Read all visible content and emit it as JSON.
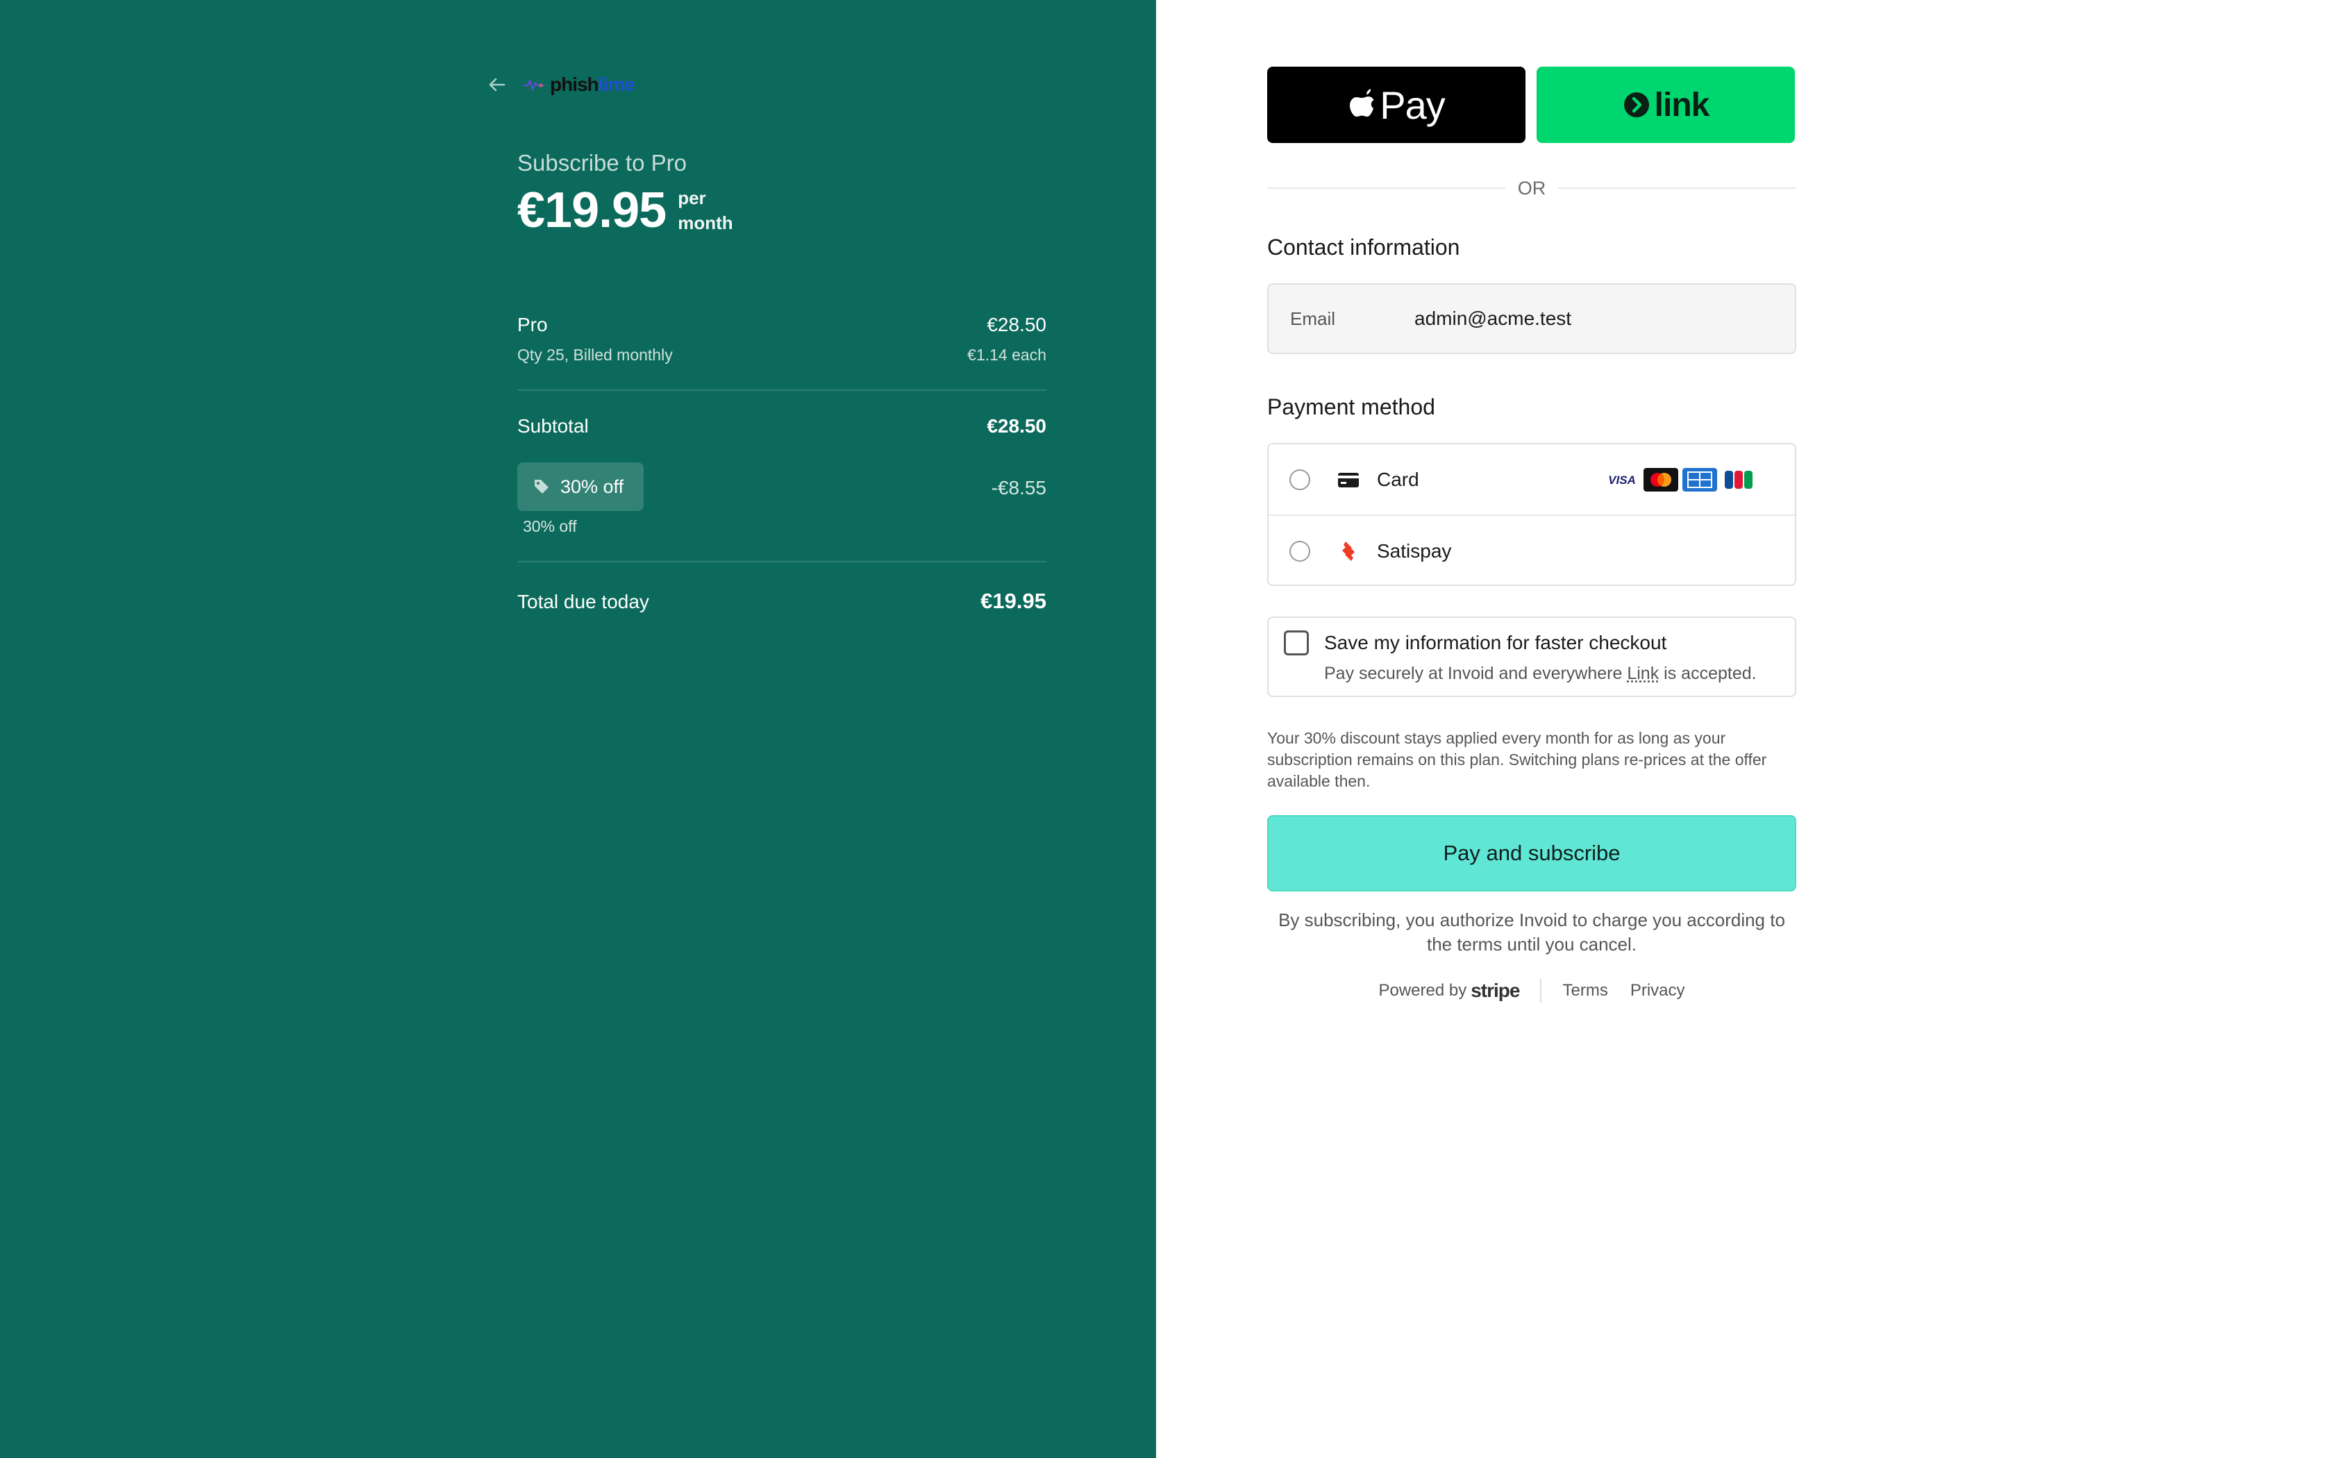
{
  "brand": {
    "logo_prefix": "phish",
    "logo_suffix": "lime",
    "logo_accent_color": "#1e4fd6"
  },
  "summary": {
    "subscribe_title": "Subscribe to Pro",
    "price": "€19.95",
    "period": "per month",
    "panel_color": "#0b6a5b",
    "line_item": {
      "name": "Pro",
      "price": "€28.50",
      "meta": "Qty 25, Billed monthly",
      "unit_price": "€1.14 each"
    },
    "subtotal_label": "Subtotal",
    "subtotal_value": "€28.50",
    "discount_badge": "30% off",
    "discount_note": "30% off",
    "discount_amount": "-€8.55",
    "total_label": "Total due today",
    "total_value": "€19.95"
  },
  "wallets": {
    "apple_pay_label": "Pay",
    "link_label": "link"
  },
  "or_text": "OR",
  "contact": {
    "title": "Contact information",
    "email_label": "Email",
    "email_value": "admin@acme.test"
  },
  "payment": {
    "title": "Payment method",
    "options": [
      {
        "label": "Card",
        "icon": "credit-card-icon",
        "brands": [
          "visa",
          "mastercard",
          "amex",
          "jcb"
        ]
      },
      {
        "label": "Satispay",
        "icon": "satispay-icon"
      }
    ]
  },
  "save_info": {
    "title": "Save my information for faster checkout",
    "desc_prefix": "Pay securely at Invoid and everywhere ",
    "desc_link": "Link",
    "desc_suffix": " is accepted."
  },
  "discount_disclaimer": "Your 30% discount stays applied every month for as long as your subscription remains on this plan. Switching plans re-prices at the offer available then.",
  "pay_button": "Pay and subscribe",
  "pay_button_color": "#5fe6d4",
  "terms_text": "By subscribing, you authorize Invoid to charge you according to the terms until you cancel.",
  "footer": {
    "powered_by": "Powered by",
    "stripe": "stripe",
    "terms": "Terms",
    "privacy": "Privacy"
  }
}
